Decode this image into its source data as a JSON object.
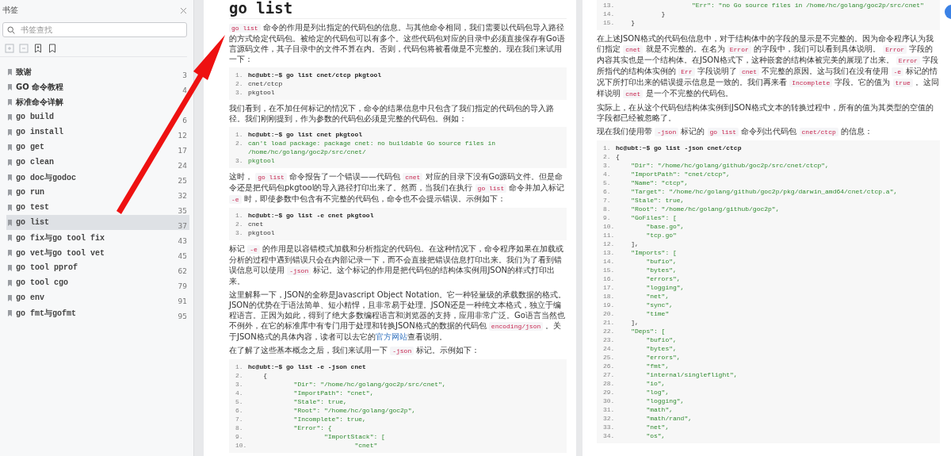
{
  "sidebar": {
    "title": "书签",
    "search": {
      "placeholder": "书签查找"
    },
    "toolbar": [
      {
        "kind": "expand",
        "disabled": true
      },
      {
        "kind": "collapse",
        "disabled": true
      },
      {
        "kind": "add",
        "disabled": false
      },
      {
        "kind": "bookmark",
        "disabled": false
      }
    ],
    "bookmarks": [
      {
        "label": "致谢",
        "page": "3",
        "kind": "heading",
        "selected": false
      },
      {
        "label": "GO 命令教程",
        "page": "4",
        "kind": "heading",
        "selected": false
      },
      {
        "label": "标准命令详解",
        "kind": "heading",
        "selected": false
      },
      {
        "label": "go build",
        "page": "6",
        "kind": "entry",
        "selected": false
      },
      {
        "label": "go install",
        "page": "12",
        "kind": "entry",
        "selected": false
      },
      {
        "label": "go get",
        "page": "17",
        "kind": "entry",
        "selected": false
      },
      {
        "label": "go clean",
        "page": "24",
        "kind": "entry",
        "selected": false
      },
      {
        "label": "go doc与godoc",
        "page": "25",
        "kind": "entry",
        "selected": false
      },
      {
        "label": "go run",
        "page": "32",
        "kind": "entry",
        "selected": false
      },
      {
        "label": "go test",
        "page": "35",
        "kind": "entry",
        "selected": false
      },
      {
        "label": "go list",
        "page": "37",
        "kind": "entry",
        "selected": true
      },
      {
        "label": "go fix与go tool fix",
        "page": "43",
        "kind": "entry",
        "selected": false
      },
      {
        "label": "go vet与go tool vet",
        "page": "45",
        "kind": "entry",
        "selected": false
      },
      {
        "label": "go tool pprof",
        "page": "62",
        "kind": "entry",
        "selected": false
      },
      {
        "label": "go tool cgo",
        "page": "79",
        "kind": "entry",
        "selected": false
      },
      {
        "label": "go env",
        "page": "91",
        "kind": "entry",
        "selected": false
      },
      {
        "label": "go fmt与gofmt",
        "page": "95",
        "kind": "entry",
        "selected": false
      }
    ]
  },
  "pages": [
    {
      "title": "go list",
      "blocks": [
        {
          "kind": "paragraph",
          "segments": [
            {
              "kind": "code",
              "text": "go list"
            },
            {
              "kind": "text",
              "text": " 命令的作用是列出指定的代码包的信息。与其他命令相同，我们需要以代码包导入路径的方式给定代码包。被给定的代码包可以有多个。这些代码包对应的目录中必须直接保存有Go语言源码文件，其子目录中的文件不算在内。否则，代码包将被看做是不完整的。现在我们来试用一下："
            }
          ]
        },
        {
          "kind": "code",
          "lines": [
            {
              "number": "1.",
              "text": "hc@ubt:~$ go list cnet/ctcp pkgtool",
              "kind": "command"
            },
            {
              "number": "2.",
              "text": "cnet/ctcp",
              "kind": "plain"
            },
            {
              "number": "3.",
              "text": "pkgtool",
              "kind": "plain"
            }
          ]
        },
        {
          "kind": "paragraph",
          "segments": [
            {
              "kind": "text",
              "text": "我们看到，在不加任何标记的情况下，命令的结果信息中只包含了我们指定的代码包的导入路径。我们刚刚提到，作为参数的代码包必须是完整的代码包。例如："
            }
          ]
        },
        {
          "kind": "code",
          "lines": [
            {
              "number": "1.",
              "text": "hc@ubt:~$ go list cnet pkgtool",
              "kind": "command"
            },
            {
              "number": "2.",
              "text": "can't load package: package cnet: no buildable Go source files in /home/hc/golang/goc2p/src/cnet/",
              "kind": "output"
            },
            {
              "number": "3.",
              "text": "pkgtool",
              "kind": "output"
            }
          ]
        },
        {
          "kind": "paragraph",
          "segments": [
            {
              "kind": "text",
              "text": "这时， "
            },
            {
              "kind": "code",
              "text": "go list"
            },
            {
              "kind": "text",
              "text": " 命令报告了一个错误——代码包 "
            },
            {
              "kind": "code",
              "text": "cnet"
            },
            {
              "kind": "text",
              "text": " 对应的目录下没有Go源码文件。但是命令还是把代码包pkgtool的导入路径打印出来了。然而，当我们在执行 "
            },
            {
              "kind": "code",
              "text": "go list"
            },
            {
              "kind": "text",
              "text": " 命令并加入标记 "
            },
            {
              "kind": "code",
              "text": "-e"
            },
            {
              "kind": "text",
              "text": " 时，即使参数中包含有不完整的代码包，命令也不会提示错误。示例如下："
            }
          ]
        },
        {
          "kind": "code",
          "lines": [
            {
              "number": "1.",
              "text": "hc@ubt:~$ go list -e cnet pkgtool",
              "kind": "command"
            },
            {
              "number": "2.",
              "text": "cnet",
              "kind": "plain"
            },
            {
              "number": "3.",
              "text": "pkgtool",
              "kind": "plain"
            }
          ]
        },
        {
          "kind": "paragraph",
          "segments": [
            {
              "kind": "text",
              "text": "标记 "
            },
            {
              "kind": "code",
              "text": "-e"
            },
            {
              "kind": "text",
              "text": " 的作用是以容错模式加载和分析指定的代码包。在这种情况下，命令程序如果在加载或分析的过程中遇到错误只会在内部记录一下，而不会直接把错误信息打印出来。我们为了看到错误信息可以使用 "
            },
            {
              "kind": "code",
              "text": "-json"
            },
            {
              "kind": "text",
              "text": " 标记。这个标记的作用是把代码包的结构体实例用JSON的样式打印出来。"
            }
          ]
        },
        {
          "kind": "paragraph",
          "segments": [
            {
              "kind": "text",
              "text": "这里解释一下，JSON的全称是Javascript Object Notation。它一种轻量级的承载数据的格式。JSON的优势在于语法简单、短小精悍，且非常易于处理。JSON还是一种纯文本格式，独立于编程语言。正因为如此，得到了绝大多数编程语言和浏览器的支持，应用非常广泛。Go语言当然也不例外，在它的标准库中有专门用于处理和转换JSON格式的数据的代码包 "
            },
            {
              "kind": "code",
              "text": "encoding/json"
            },
            {
              "kind": "text",
              "text": " 。关于JSON格式的具体内容，读者可以去它的"
            },
            {
              "kind": "link",
              "text": "官方网站"
            },
            {
              "kind": "text",
              "text": "查看说明。"
            }
          ]
        },
        {
          "kind": "paragraph",
          "segments": [
            {
              "kind": "text",
              "text": "在了解了这些基本概念之后，我们来试用一下 "
            },
            {
              "kind": "code",
              "text": "-json"
            },
            {
              "kind": "text",
              "text": " 标记。示例如下："
            }
          ]
        },
        {
          "kind": "code",
          "lines": [
            {
              "number": "1.",
              "text": "hc@ubt:~$ go list -e -json cnet",
              "kind": "command"
            },
            {
              "number": "2.",
              "text": "    {",
              "kind": "plain"
            },
            {
              "number": "3.",
              "text": "            \"Dir\": \"/home/hc/golang/goc2p/src/cnet\",",
              "kind": "output"
            },
            {
              "number": "4.",
              "text": "            \"ImportPath\": \"cnet\",",
              "kind": "output"
            },
            {
              "number": "5.",
              "text": "            \"Stale\": true,",
              "kind": "output"
            },
            {
              "number": "6.",
              "text": "            \"Root\": \"/home/hc/golang/goc2p\",",
              "kind": "output"
            },
            {
              "number": "7.",
              "text": "            \"Incomplete\": true,",
              "kind": "output"
            },
            {
              "number": "8.",
              "text": "            \"Error\": {",
              "kind": "output"
            },
            {
              "number": "9.",
              "text": "                    \"ImportStack\": [",
              "kind": "output"
            },
            {
              "number": "10.",
              "text": "                            \"cnet\"",
              "kind": "output"
            }
          ]
        }
      ]
    },
    {
      "blocks": [
        {
          "kind": "code",
          "lines": [
            {
              "number": "13.",
              "text": "                    \"Err\": \"no Go source files in /home/hc/golang/goc2p/src/cnet\"",
              "kind": "output"
            },
            {
              "number": "14.",
              "text": "            }",
              "kind": "plain"
            },
            {
              "number": "15.",
              "text": "    }",
              "kind": "plain"
            }
          ]
        },
        {
          "kind": "paragraph",
          "segments": [
            {
              "kind": "text",
              "text": "在上述JSON格式的代码包信息中，对于结构体中的字段的显示是不完整的。因为命令程序认为我们指定 "
            },
            {
              "kind": "code",
              "text": "cnet"
            },
            {
              "kind": "text",
              "text": " 就是不完整的。在名为 "
            },
            {
              "kind": "code",
              "text": "Error"
            },
            {
              "kind": "text",
              "text": " 的字段中，我们可以看到具体说明。 "
            },
            {
              "kind": "code",
              "text": "Error"
            },
            {
              "kind": "text",
              "text": " 字段的内容其实也是一个结构体。在JSON格式下，这种嵌套的结构体被完美的展现了出来。 "
            },
            {
              "kind": "code",
              "text": "Error"
            },
            {
              "kind": "text",
              "text": " 字段所指代的结构体实例的 "
            },
            {
              "kind": "code",
              "text": "Err"
            },
            {
              "kind": "text",
              "text": " 字段说明了 "
            },
            {
              "kind": "code",
              "text": "cnet"
            },
            {
              "kind": "text",
              "text": " 不完整的原因。这与我们在没有使用 "
            },
            {
              "kind": "code",
              "text": "-e"
            },
            {
              "kind": "text",
              "text": " 标记的情况下所打印出来的错误提示信息是一致的。我们再来看 "
            },
            {
              "kind": "code",
              "text": "Incomplete"
            },
            {
              "kind": "text",
              "text": " 字段。它的值为 "
            },
            {
              "kind": "code",
              "text": "true"
            },
            {
              "kind": "text",
              "text": " 。这同样说明 "
            },
            {
              "kind": "code",
              "text": "cnet"
            },
            {
              "kind": "text",
              "text": " 是一个不完整的代码包。"
            }
          ]
        },
        {
          "kind": "paragraph",
          "segments": [
            {
              "kind": "text",
              "text": "实际上，在从这个代码包结构体实例到JSON格式文本的转换过程中，所有的值为其类型的空值的字段都已经被忽略了。"
            }
          ]
        },
        {
          "kind": "paragraph",
          "segments": [
            {
              "kind": "text",
              "text": "现在我们使用带 "
            },
            {
              "kind": "code",
              "text": "-json"
            },
            {
              "kind": "text",
              "text": " 标记的 "
            },
            {
              "kind": "code",
              "text": "go list"
            },
            {
              "kind": "text",
              "text": " 命令列出代码包 "
            },
            {
              "kind": "code",
              "text": "cnet/ctcp"
            },
            {
              "kind": "text",
              "text": " 的信息："
            }
          ]
        },
        {
          "kind": "code",
          "lines": [
            {
              "number": "1.",
              "text": "hc@ubt:~$ go list -json cnet/ctcp",
              "kind": "command"
            },
            {
              "number": "2.",
              "text": "{",
              "kind": "plain"
            },
            {
              "number": "3.",
              "text": "    \"Dir\": \"/home/hc/golang/github/goc2p/src/cnet/ctcp\",",
              "kind": "output"
            },
            {
              "number": "4.",
              "text": "    \"ImportPath\": \"cnet/ctcp\",",
              "kind": "output"
            },
            {
              "number": "5.",
              "text": "    \"Name\": \"ctcp\",",
              "kind": "output"
            },
            {
              "number": "6.",
              "text": "    \"Target\": \"/home/hc/golang/github/goc2p/pkg/darwin_amd64/cnet/ctcp.a\",",
              "kind": "output"
            },
            {
              "number": "7.",
              "text": "    \"Stale\": true,",
              "kind": "output"
            },
            {
              "number": "8.",
              "text": "    \"Root\": \"/home/hc/golang/github/goc2p\",",
              "kind": "output"
            },
            {
              "number": "9.",
              "text": "    \"GoFiles\": [",
              "kind": "output"
            },
            {
              "number": "10.",
              "text": "        \"base.go\",",
              "kind": "output"
            },
            {
              "number": "11.",
              "text": "        \"tcp.go\"",
              "kind": "output"
            },
            {
              "number": "12.",
              "text": "    ],",
              "kind": "plain"
            },
            {
              "number": "13.",
              "text": "    \"Imports\": [",
              "kind": "output"
            },
            {
              "number": "14.",
              "text": "        \"bufio\",",
              "kind": "output"
            },
            {
              "number": "15.",
              "text": "        \"bytes\",",
              "kind": "output"
            },
            {
              "number": "16.",
              "text": "        \"errors\",",
              "kind": "output"
            },
            {
              "number": "17.",
              "text": "        \"logging\",",
              "kind": "output"
            },
            {
              "number": "18.",
              "text": "        \"net\",",
              "kind": "output"
            },
            {
              "number": "19.",
              "text": "        \"sync\",",
              "kind": "output"
            },
            {
              "number": "20.",
              "text": "        \"time\"",
              "kind": "output"
            },
            {
              "number": "21.",
              "text": "    ],",
              "kind": "plain"
            },
            {
              "number": "22.",
              "text": "    \"Deps\": [",
              "kind": "output"
            },
            {
              "number": "23.",
              "text": "        \"bufio\",",
              "kind": "output"
            },
            {
              "number": "24.",
              "text": "        \"bytes\",",
              "kind": "output"
            },
            {
              "number": "25.",
              "text": "        \"errors\",",
              "kind": "output"
            },
            {
              "number": "26.",
              "text": "        \"fmt\",",
              "kind": "output"
            },
            {
              "number": "27.",
              "text": "        \"internal/singleflight\",",
              "kind": "output"
            },
            {
              "number": "28.",
              "text": "        \"io\",",
              "kind": "output"
            },
            {
              "number": "29.",
              "text": "        \"log\",",
              "kind": "output"
            },
            {
              "number": "30.",
              "text": "        \"logging\",",
              "kind": "output"
            },
            {
              "number": "31.",
              "text": "        \"math\",",
              "kind": "output"
            },
            {
              "number": "32.",
              "text": "        \"math/rand\",",
              "kind": "output"
            },
            {
              "number": "33.",
              "text": "        \"net\",",
              "kind": "output"
            },
            {
              "number": "34.",
              "text": "        \"os\",",
              "kind": "output"
            }
          ]
        }
      ]
    }
  ]
}
